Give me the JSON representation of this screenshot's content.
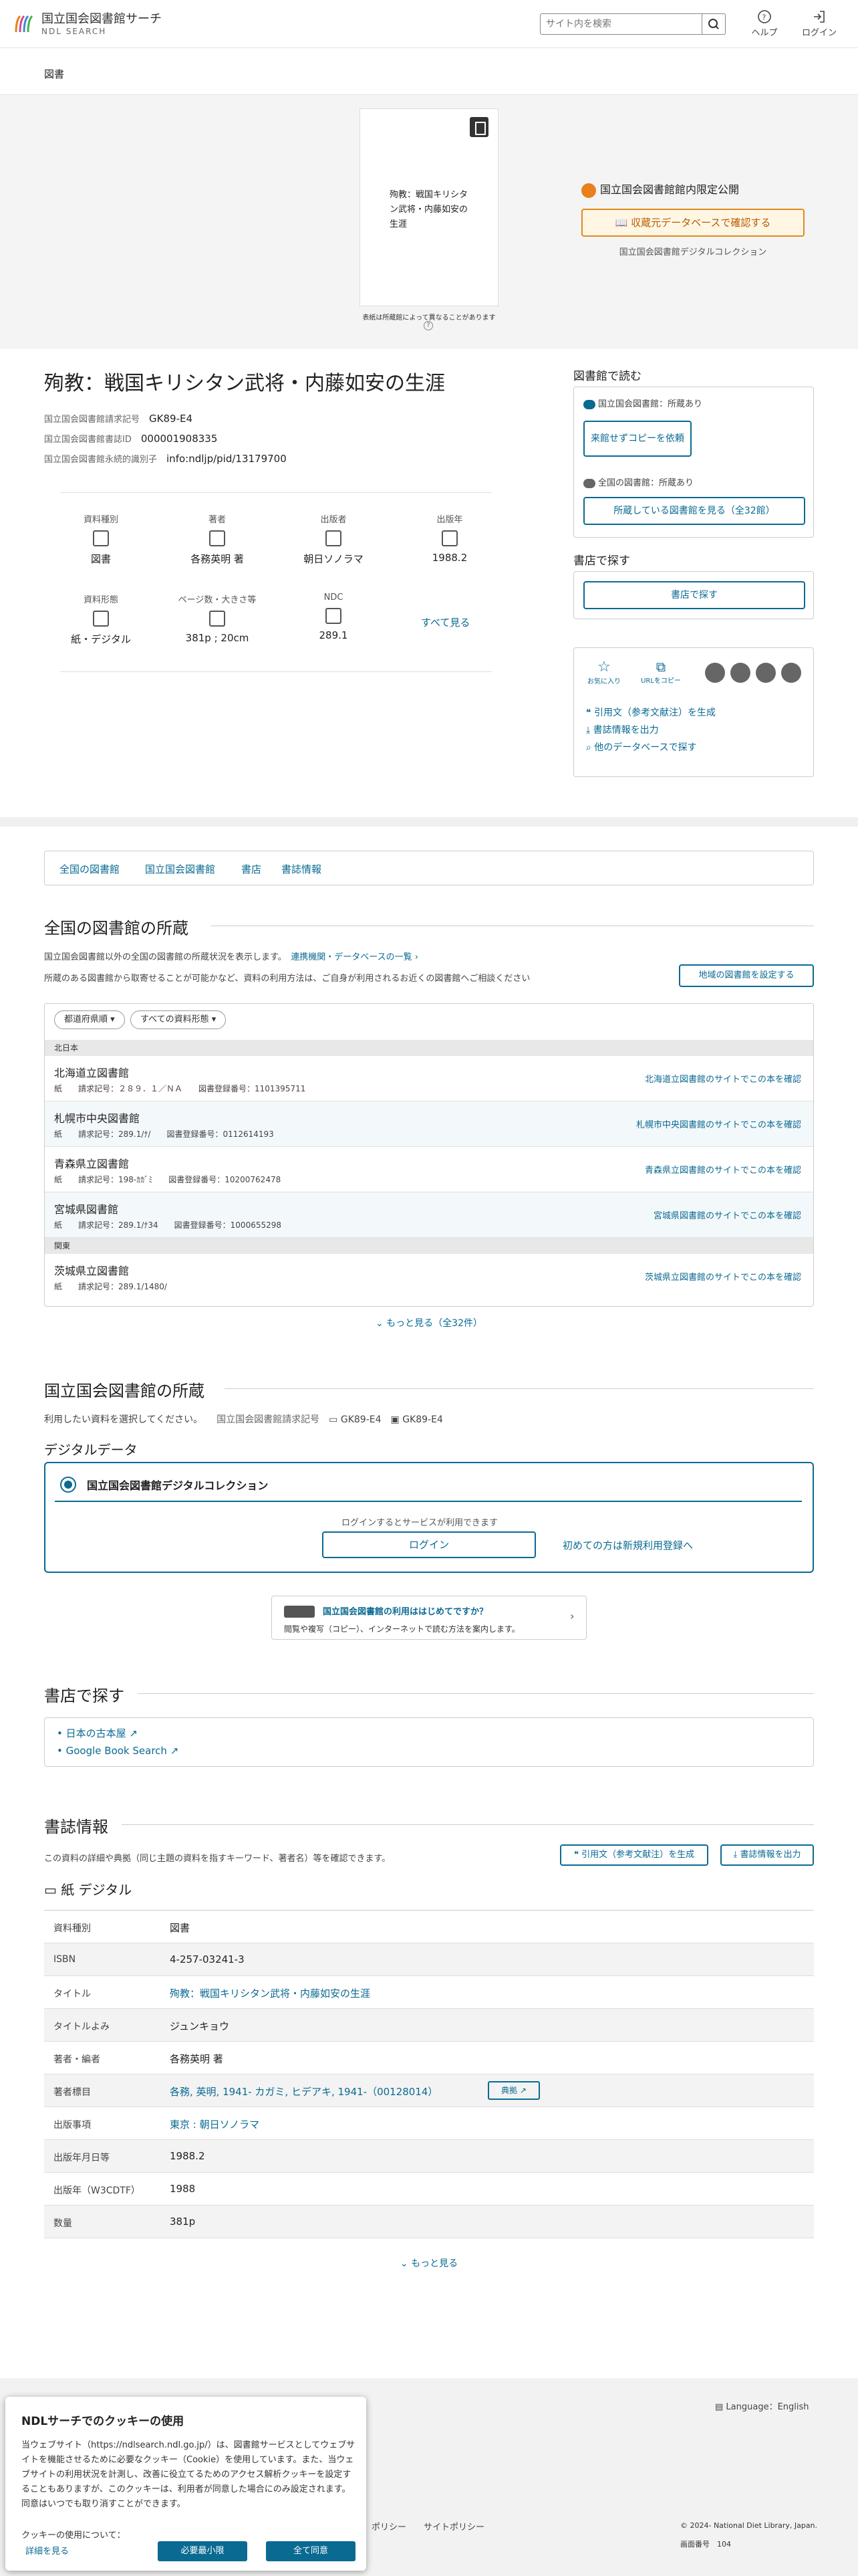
{
  "header": {
    "logo_jp": "国立国会図書館サーチ",
    "logo_en": "NDL SEARCH",
    "search_placeholder": "サイト内を検索",
    "help": "ヘルプ",
    "login": "ログイン"
  },
  "breadcrumb": "図書",
  "cover": {
    "text": "殉教：戦国キリシタン武将・内藤如安の生涯",
    "note": "表紙は所蔵館によって異なることがあります"
  },
  "access": {
    "limited": "国立国会図書館館内限定公開",
    "confirm_btn": "収蔵元データベースで確認する",
    "collection": "国立国会図書館デジタルコレクション"
  },
  "book": {
    "title": "殉教：戦国キリシタン武将・内藤如安の生涯",
    "callno_label": "国立国会図書館請求記号",
    "callno": "GK89-E4",
    "id_label": "国立国会図書館書誌ID",
    "id": "000001908335",
    "pid_label": "国立国会図書館永続的識別子",
    "pid": "info:ndljp/pid/13179700"
  },
  "meta": [
    {
      "label": "資料種別",
      "value": "図書"
    },
    {
      "label": "著者",
      "value": "各務英明 著"
    },
    {
      "label": "出版者",
      "value": "朝日ソノラマ"
    },
    {
      "label": "出版年",
      "value": "1988.2"
    },
    {
      "label": "資料形態",
      "value": "紙・デジタル"
    },
    {
      "label": "ページ数・大きさ等",
      "value": "381p ; 20cm"
    },
    {
      "label": "NDC",
      "value": "289.1"
    }
  ],
  "see_all": "すべて見る",
  "right": {
    "read_h": "図書館で読む",
    "ndl_has": "国立国会図書館：所蔵あり",
    "copy_btn": "来館せずコピーを依頼",
    "all_has": "全国の図書館：所蔵あり",
    "all_btn": "所蔵している図書館を見る（全32館）",
    "shop_h": "書店で探す",
    "shop_btn": "書店で探す",
    "fav": "お気に入り",
    "urlcopy": "URLをコピー",
    "cite": "引用文（参考文献注）を生成",
    "export": "書誌情報を出力",
    "other": "他のデータベースで探す"
  },
  "nav": [
    "全国の図書館",
    "国立国会図書館",
    "書店",
    "書誌情報"
  ],
  "holdings": {
    "h": "全国の図書館の所蔵",
    "desc1": "国立国会図書館以外の全国の図書館の所蔵状況を表示します。",
    "desc1_link": "連携機関・データベースの一覧",
    "desc2": "所蔵のある図書館から取寄せることが可能かなど、資料の利用方法は、ご自身が利用されるお近くの図書館へご相談ください",
    "region_btn": "地域の図書館を設定する",
    "chip1": "都道府県順",
    "chip2": "すべての資料形態",
    "r1": "北日本",
    "r2": "関東",
    "libs": [
      {
        "name": "北海道立図書館",
        "sub": "紙　　請求記号：２８９．１／ＮＡ　　図書登録番号：1101395711",
        "go": "北海道立図書館のサイトでこの本を確認"
      },
      {
        "name": "札幌市中央図書館",
        "sub": "紙　　請求記号：289.1/ﾅ/　　図書登録番号：0112614193",
        "go": "札幌市中央図書館のサイトでこの本を確認"
      },
      {
        "name": "青森県立図書館",
        "sub": "紙　　請求記号：198-ｶｶﾞﾐ　　図書登録番号：10200762478",
        "go": "青森県立図書館のサイトでこの本を確認"
      },
      {
        "name": "宮城県図書館",
        "sub": "紙　　請求記号：289.1/ﾅ34　　図書登録番号：1000655298",
        "go": "宮城県図書館のサイトでこの本を確認"
      },
      {
        "name": "茨城県立図書館",
        "sub": "紙　　請求記号：289.1/1480/",
        "go": "茨城県立図書館のサイトでこの本を確認"
      }
    ],
    "more": "もっと見る（全32件）"
  },
  "ndl": {
    "h": "国立国会図書館の所蔵",
    "select": "利用したい資料を選択してください。",
    "callno_label": "国立国会図書館請求記号",
    "c1": "GK89-E4",
    "c2": "GK89-E4",
    "digital_h": "デジタルデータ",
    "dc": "国立国会図書館デジタルコレクション",
    "login_note": "ログインするとサービスが利用できます",
    "login": "ログイン",
    "register": "初めての方は新規利用登録へ",
    "guide_t": "国立国会図書館の利用ははじめてですか？",
    "guide_s": "閲覧や複写（コピー）、インターネットで読む方法を案内します。"
  },
  "shop": {
    "h": "書店で探す",
    "l1": "日本の古本屋",
    "l2": "Google Book Search"
  },
  "biblio": {
    "h": "書誌情報",
    "desc": "この資料の詳細や典拠（同じ主題の資料を指すキーワード、著者名）等を確認できます。",
    "cite": "引用文（参考文献注）を生成",
    "export": "書誌情報を出力",
    "types": "紙  デジタル",
    "rows": [
      {
        "k": "資料種別",
        "v": "図書"
      },
      {
        "k": "ISBN",
        "v": "4-257-03241-3"
      },
      {
        "k": "タイトル",
        "v": "殉教：戦国キリシタン武将・内藤如安の生涯"
      },
      {
        "k": "タイトルよみ",
        "v": "ジュンキョウ"
      },
      {
        "k": "著者・編者",
        "v": "各務英明 著"
      },
      {
        "k": "著者標目",
        "v": "各務, 英明, 1941- カガミ, ヒデアキ, 1941-（00128014）"
      },
      {
        "k": "出版事項",
        "v": "東京 : 朝日ソノラマ"
      },
      {
        "k": "出版年月日等",
        "v": "1988.2"
      },
      {
        "k": "出版年（W3CDTF）",
        "v": "1988"
      },
      {
        "k": "数量",
        "v": "381p"
      }
    ],
    "tenkyo": "典拠",
    "more": "もっと見る"
  },
  "footer": {
    "lang": "Language：English",
    "policy1": "ポリシー",
    "policy2": "サイトポリシー",
    "copyright": "© 2024- National Diet Library, Japan.",
    "page": "画面番号",
    "pageno": "104"
  },
  "cookie": {
    "h": "NDLサーチでのクッキーの使用",
    "text": "当ウェブサイト（https://ndlsearch.ndl.go.jp/）は、図書館サービスとしてウェブサイトを機能させるために必要なクッキー（Cookie）を使用しています。また、当ウェブサイトの利用状況を計測し、改善に役立てるためのアクセス解析クッキーを設定することもありますが、このクッキーは、利用者が同意した場合にのみ設定されます。同意はいつでも取り消すことができます。",
    "use": "クッキーの使用について：",
    "detail": "詳細を見る",
    "necessary": "必要最小限",
    "accept": "全て同意"
  },
  "colors": {
    "accent": "#0a6a92",
    "orange": "#e08a1c"
  }
}
